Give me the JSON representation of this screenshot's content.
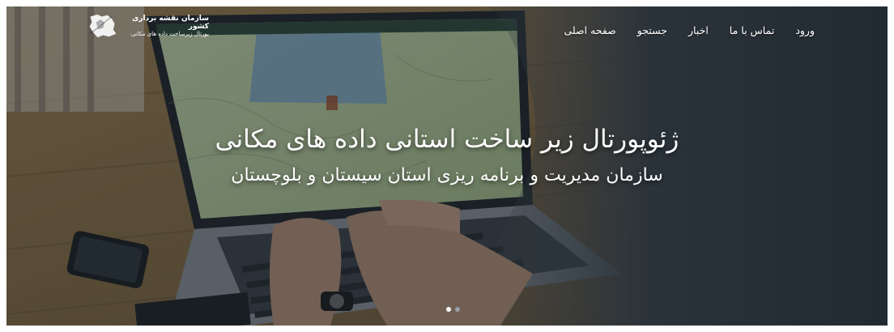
{
  "header": {
    "logo": {
      "title": "سازمان نقشه برداری کشور",
      "subtitle": "پورتال زیرساخت داده های مکانی"
    },
    "nav": [
      {
        "label": "صفحه اصلی"
      },
      {
        "label": "جستجو"
      },
      {
        "label": "اخبار"
      },
      {
        "label": "تماس با ما"
      },
      {
        "label": "ورود"
      }
    ]
  },
  "hero": {
    "title": "ژئوپورتال زیر ساخت استانی داده های مکانی",
    "subtitle": "سازمان مدیریت و برنامه ریزی استان سیستان و بلوچستان"
  },
  "carousel": {
    "slides": 2,
    "active": 1
  },
  "colors": {
    "overlay": "#1c252e",
    "text": "#ffffff",
    "dot_active": "#ffffff",
    "dot_inactive": "#9aa1a8"
  }
}
